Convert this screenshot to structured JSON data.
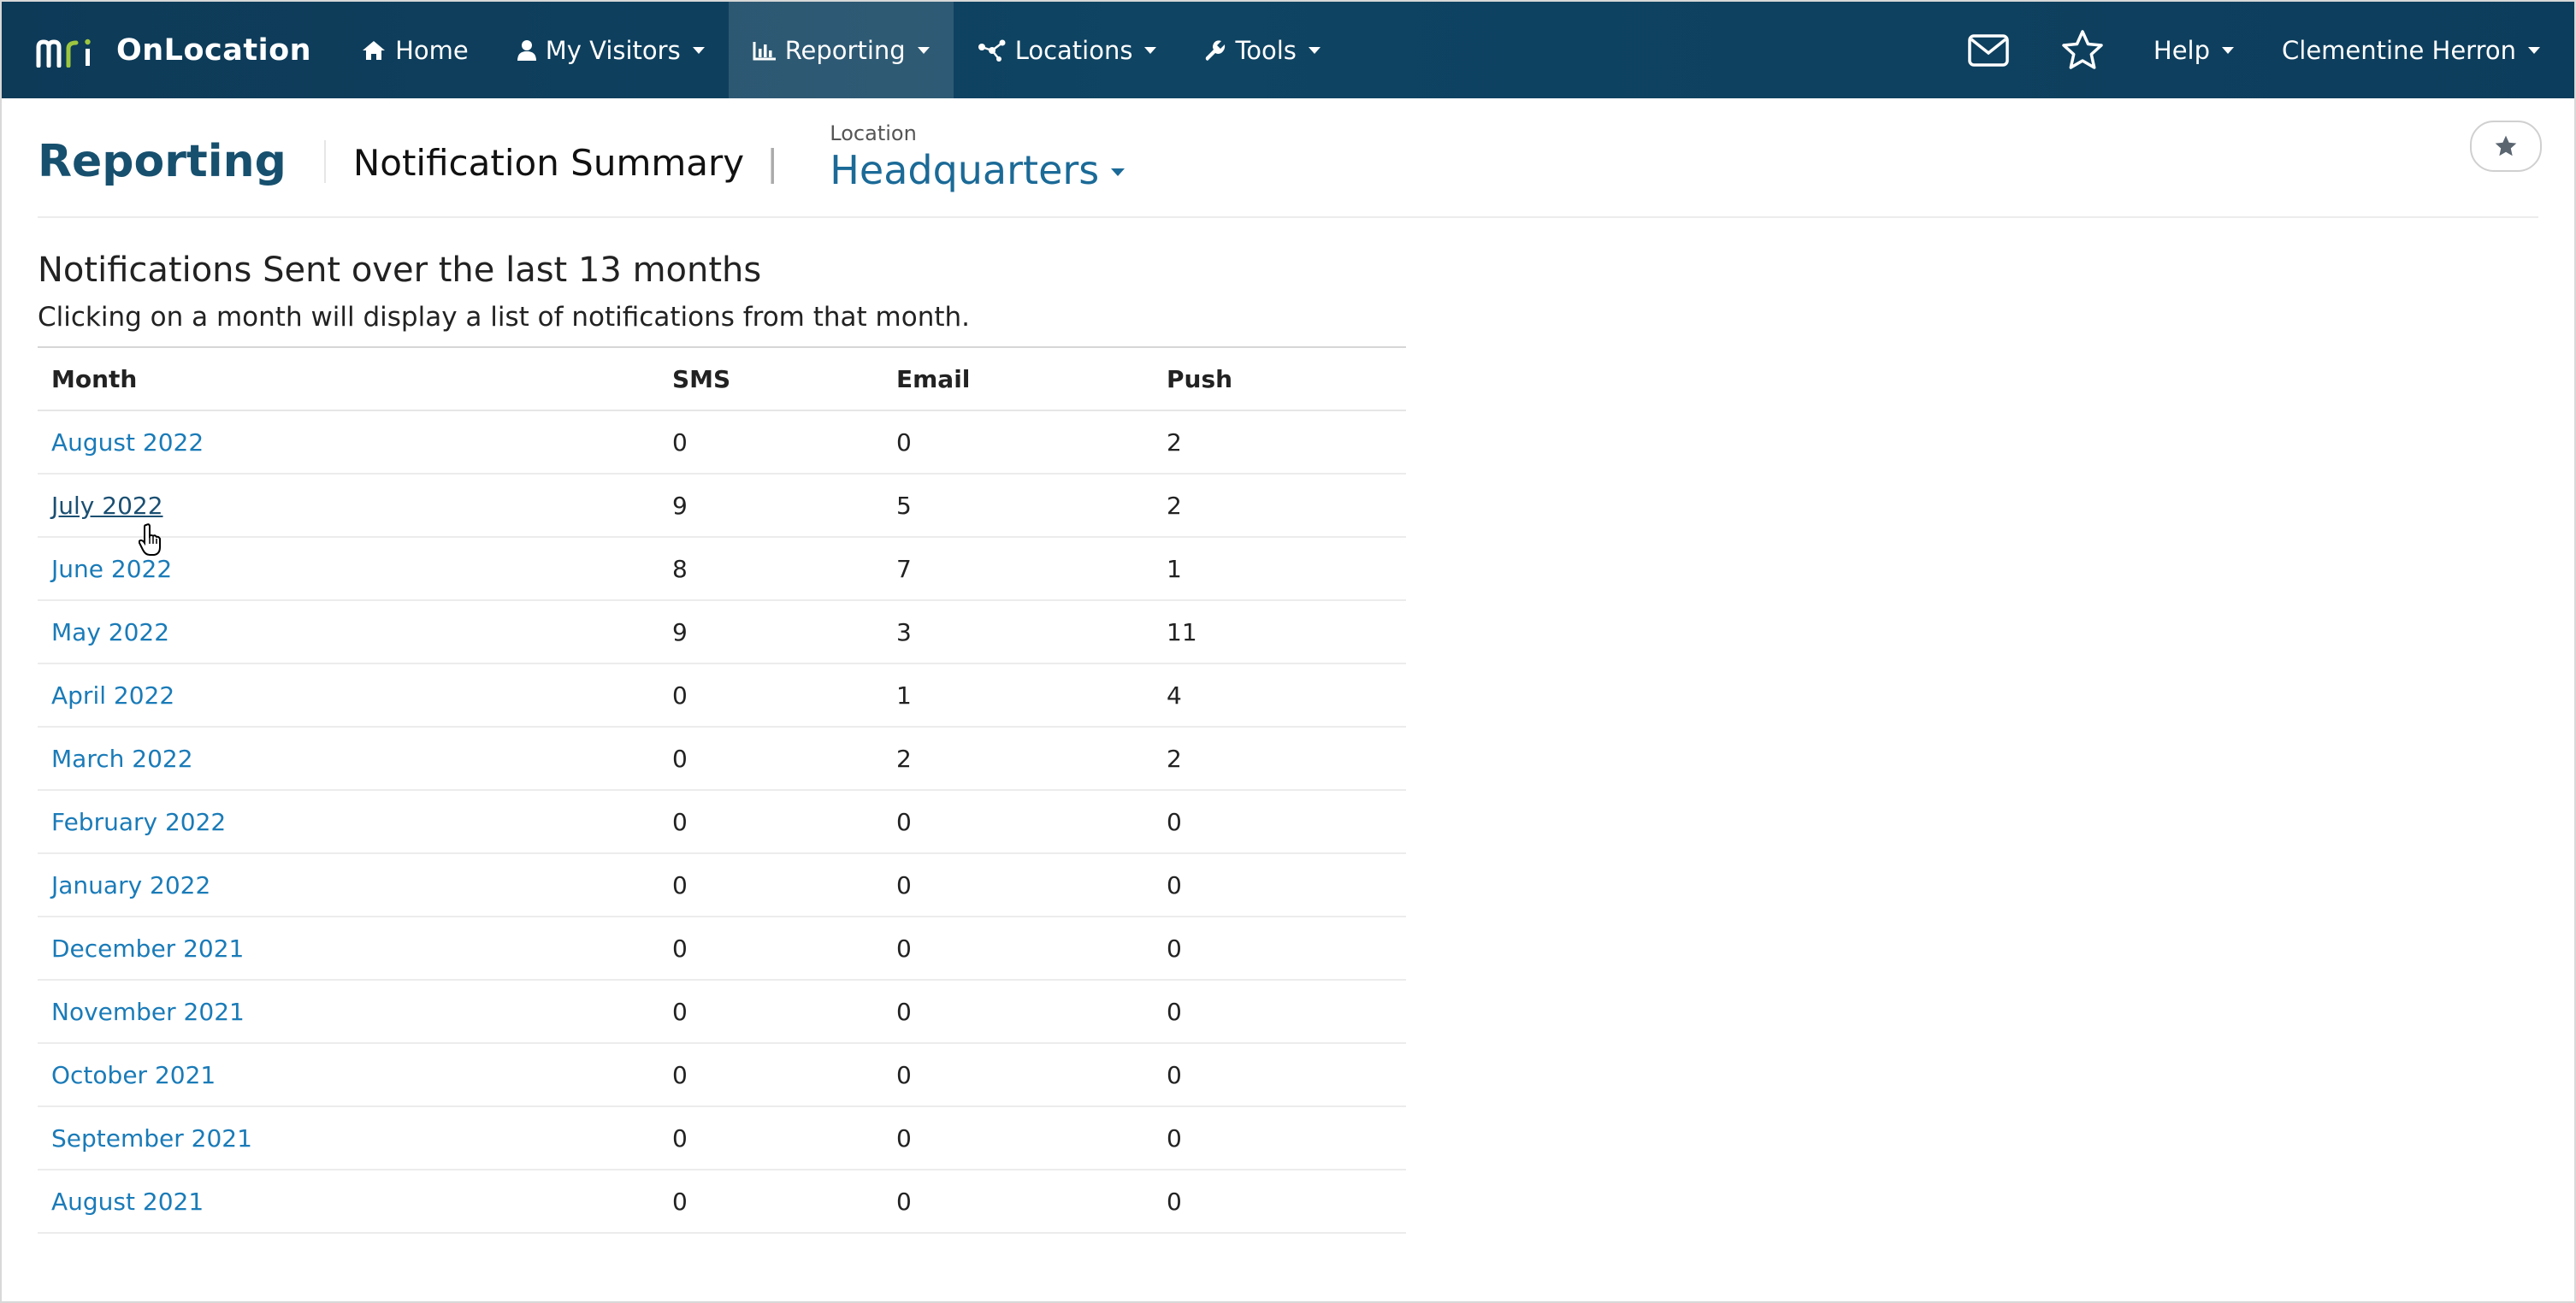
{
  "colors": {
    "nav_bg": "#0f4463",
    "title": "#17506e",
    "link": "#1a7bb8",
    "logo_accent": "#9dc63f"
  },
  "navbar": {
    "brand_logo_text": "mri",
    "brand_name": "OnLocation",
    "items": [
      {
        "label": "Home",
        "icon": "home-icon",
        "dropdown": false,
        "active": false
      },
      {
        "label": "My Visitors",
        "icon": "user-icon",
        "dropdown": true,
        "active": false
      },
      {
        "label": "Reporting",
        "icon": "bar-chart-icon",
        "dropdown": true,
        "active": true
      },
      {
        "label": "Locations",
        "icon": "network-icon",
        "dropdown": true,
        "active": false
      },
      {
        "label": "Tools",
        "icon": "wrench-icon",
        "dropdown": true,
        "active": false
      }
    ],
    "right": {
      "mail_icon": "envelope-icon",
      "favorites_icon": "star-outline-icon",
      "help_label": "Help",
      "user_label": "Clementine Herron"
    }
  },
  "header": {
    "title": "Reporting",
    "subtitle": "Notification Summary",
    "separator": "|",
    "location_label": "Location",
    "location_value": "Headquarters",
    "favorite_icon": "star-icon"
  },
  "section": {
    "title": "Notifications Sent over the last 13 months",
    "description": "Clicking on a month will display a list of notifications from that month."
  },
  "table": {
    "columns": [
      "Month",
      "SMS",
      "Email",
      "Push"
    ],
    "rows": [
      {
        "month": "August 2022",
        "sms": "0",
        "email": "0",
        "push": "2"
      },
      {
        "month": "July 2022",
        "sms": "9",
        "email": "5",
        "push": "2"
      },
      {
        "month": "June 2022",
        "sms": "8",
        "email": "7",
        "push": "1"
      },
      {
        "month": "May 2022",
        "sms": "9",
        "email": "3",
        "push": "11"
      },
      {
        "month": "April 2022",
        "sms": "0",
        "email": "1",
        "push": "4"
      },
      {
        "month": "March 2022",
        "sms": "0",
        "email": "2",
        "push": "2"
      },
      {
        "month": "February 2022",
        "sms": "0",
        "email": "0",
        "push": "0"
      },
      {
        "month": "January 2022",
        "sms": "0",
        "email": "0",
        "push": "0"
      },
      {
        "month": "December 2021",
        "sms": "0",
        "email": "0",
        "push": "0"
      },
      {
        "month": "November 2021",
        "sms": "0",
        "email": "0",
        "push": "0"
      },
      {
        "month": "October 2021",
        "sms": "0",
        "email": "0",
        "push": "0"
      },
      {
        "month": "September 2021",
        "sms": "0",
        "email": "0",
        "push": "0"
      },
      {
        "month": "August 2021",
        "sms": "0",
        "email": "0",
        "push": "0"
      }
    ],
    "hovered_row": 1
  }
}
